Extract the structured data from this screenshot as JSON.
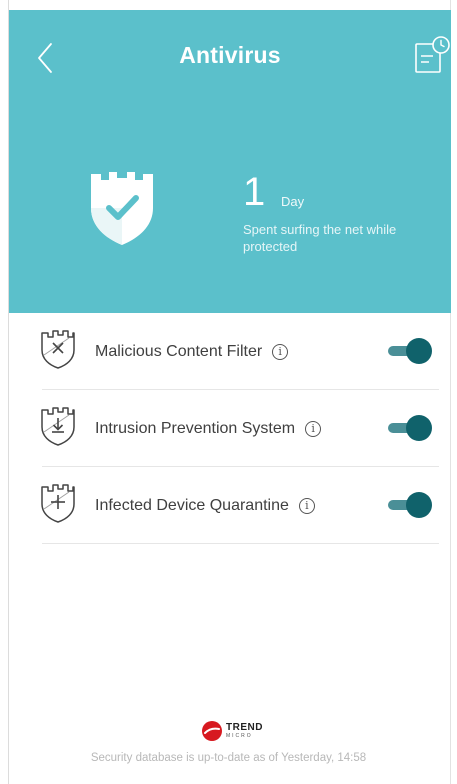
{
  "header": {
    "title": "Antivirus",
    "back_icon": "chevron-left-icon",
    "log_icon": "history-log-icon",
    "background_color": "#5bc0cb"
  },
  "summary": {
    "count": "1",
    "unit": "Day",
    "description": "Spent surfing the net while protected"
  },
  "features": [
    {
      "label": "Malicious Content Filter",
      "icon": "shield-x-icon",
      "enabled": true
    },
    {
      "label": "Intrusion Prevention System",
      "icon": "shield-arrow-down-icon",
      "enabled": true
    },
    {
      "label": "Infected Device Quarantine",
      "icon": "shield-plus-icon",
      "enabled": true
    }
  ],
  "footer": {
    "brand_line1": "TREND",
    "brand_line2": "MICRO",
    "status": "Security database is up-to-date as of Yesterday, 14:58"
  },
  "colors": {
    "toggle_on_knob": "#10626b",
    "toggle_on_track": "#4a8f97"
  }
}
